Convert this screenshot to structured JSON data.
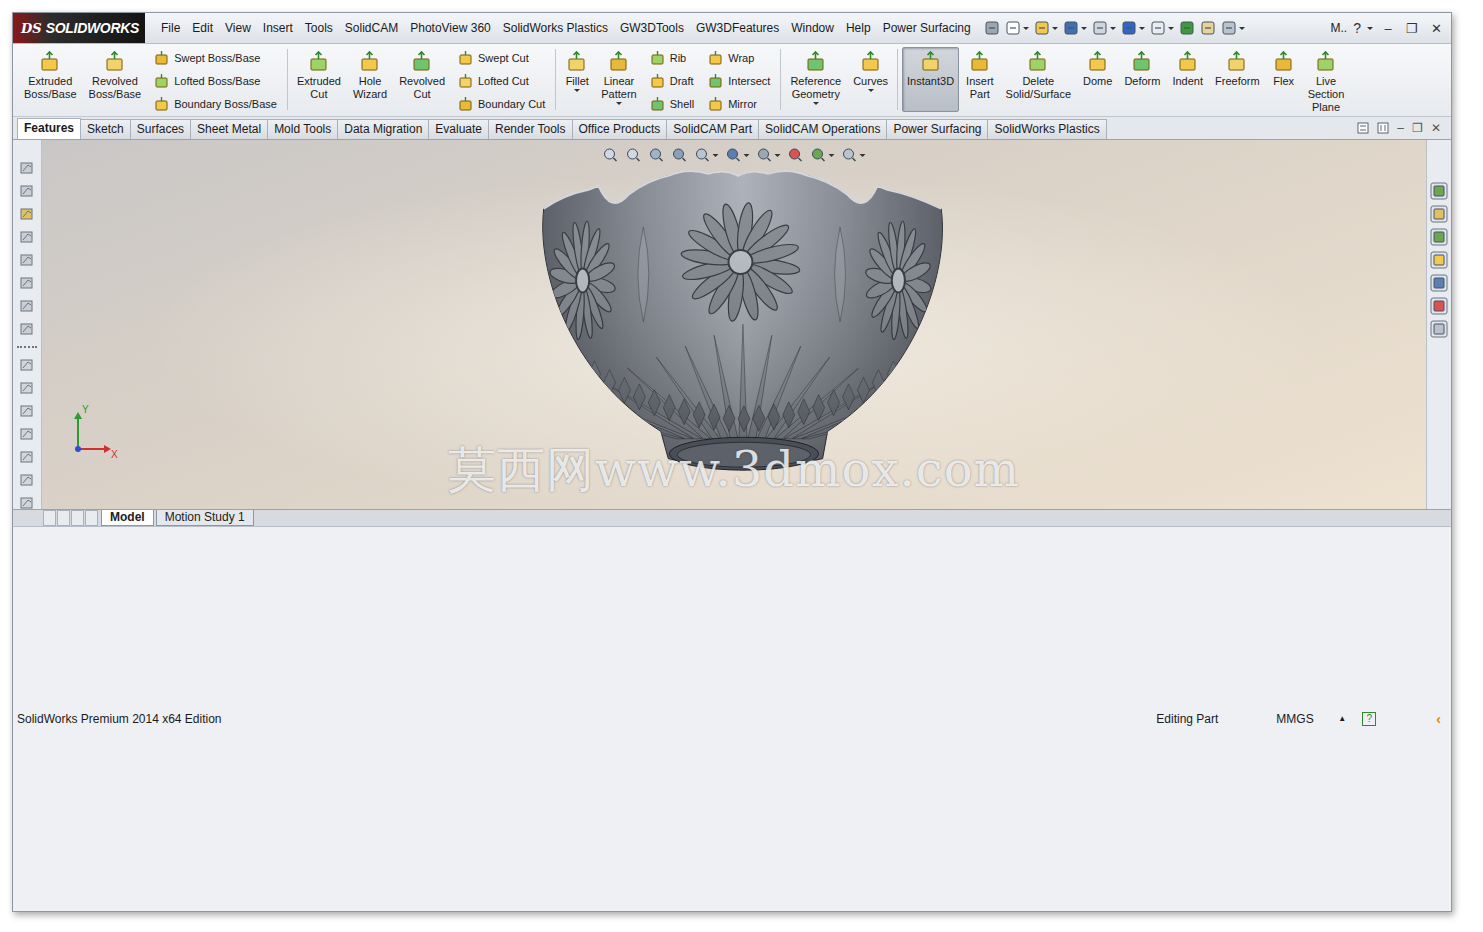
{
  "app": {
    "logo_mark": "DS",
    "logo": "SOLIDWORKS"
  },
  "menu": [
    "File",
    "Edit",
    "View",
    "Insert",
    "Tools",
    "SolidCAM",
    "PhotoView 360",
    "SolidWorks Plastics",
    "GW3DTools",
    "GW3DFeatures",
    "Window",
    "Help",
    "Power Surfacing"
  ],
  "title_tools": {
    "user": "M..",
    "help": "?"
  },
  "window_controls": [
    "–",
    "❐",
    "✕"
  ],
  "commands": [
    {
      "kind": "large",
      "label": "Extruded Boss/Base",
      "dropdown": false,
      "selected": false,
      "group_start": false
    },
    {
      "kind": "large",
      "label": "Revolved Boss/Base",
      "dropdown": false,
      "selected": false,
      "group_start": false
    },
    {
      "kind": "stack",
      "items": [
        "Swept Boss/Base",
        "Lofted Boss/Base",
        "Boundary Boss/Base"
      ],
      "group_start": false
    },
    {
      "kind": "large",
      "label": "Extruded Cut",
      "dropdown": false,
      "selected": false,
      "group_start": true
    },
    {
      "kind": "large",
      "label": "Hole Wizard",
      "dropdown": false,
      "selected": false,
      "group_start": false
    },
    {
      "kind": "large",
      "label": "Revolved Cut",
      "dropdown": false,
      "selected": false,
      "group_start": false
    },
    {
      "kind": "stack",
      "items": [
        "Swept Cut",
        "Lofted Cut",
        "Boundary Cut"
      ],
      "group_start": false
    },
    {
      "kind": "large",
      "label": "Fillet",
      "dropdown": true,
      "selected": false,
      "group_start": true
    },
    {
      "kind": "large",
      "label": "Linear Pattern",
      "dropdown": true,
      "selected": false,
      "group_start": false
    },
    {
      "kind": "stack",
      "items": [
        "Rib",
        "Draft",
        "Shell"
      ],
      "group_start": false
    },
    {
      "kind": "stack",
      "items": [
        "Wrap",
        "Intersect",
        "Mirror"
      ],
      "group_start": false
    },
    {
      "kind": "large",
      "label": "Reference Geometry",
      "dropdown": true,
      "selected": false,
      "group_start": true
    },
    {
      "kind": "large",
      "label": "Curves",
      "dropdown": true,
      "selected": false,
      "group_start": false
    },
    {
      "kind": "large",
      "label": "Instant3D",
      "dropdown": false,
      "selected": true,
      "group_start": true
    },
    {
      "kind": "large",
      "label": "Insert Part",
      "dropdown": false,
      "selected": false,
      "group_start": false
    },
    {
      "kind": "large",
      "label": "Delete Solid/Surface",
      "dropdown": false,
      "selected": false,
      "group_start": false
    },
    {
      "kind": "large",
      "label": "Dome",
      "dropdown": false,
      "selected": false,
      "group_start": false
    },
    {
      "kind": "large",
      "label": "Deform",
      "dropdown": false,
      "selected": false,
      "group_start": false
    },
    {
      "kind": "large",
      "label": "Indent",
      "dropdown": false,
      "selected": false,
      "group_start": false
    },
    {
      "kind": "large",
      "label": "Freeform",
      "dropdown": false,
      "selected": false,
      "group_start": false
    },
    {
      "kind": "large",
      "label": "Flex",
      "dropdown": false,
      "selected": false,
      "group_start": false
    },
    {
      "kind": "large",
      "label": "Live Section Plane",
      "dropdown": false,
      "selected": false,
      "group_start": false
    }
  ],
  "tabs": [
    {
      "label": "Features",
      "selected": true
    },
    {
      "label": "Sketch",
      "selected": false
    },
    {
      "label": "Surfaces",
      "selected": false
    },
    {
      "label": "Sheet Metal",
      "selected": false
    },
    {
      "label": "Mold Tools",
      "selected": false
    },
    {
      "label": "Data Migration",
      "selected": false
    },
    {
      "label": "Evaluate",
      "selected": false
    },
    {
      "label": "Render Tools",
      "selected": false
    },
    {
      "label": "Office Products",
      "selected": false
    },
    {
      "label": "SolidCAM Part",
      "selected": false
    },
    {
      "label": "SolidCAM Operations",
      "selected": false
    },
    {
      "label": "Power Surfacing",
      "selected": false
    },
    {
      "label": "SolidWorks Plastics",
      "selected": false
    }
  ],
  "document_controls": [
    "–",
    "❐",
    "✕"
  ],
  "viewport": {
    "watermark": "莫西网www.3dmox.com",
    "triad": {
      "x": "X",
      "y": "Y"
    }
  },
  "bottom_tabs": [
    {
      "label": "Model",
      "selected": true
    },
    {
      "label": "Motion Study 1",
      "selected": false
    }
  ],
  "status_bar": {
    "product": "SolidWorks Premium 2014 x64 Edition",
    "mode": "Editing Part",
    "units": "MMGS",
    "units_arrow": "▲",
    "help": "?",
    "collapse": "‹"
  }
}
